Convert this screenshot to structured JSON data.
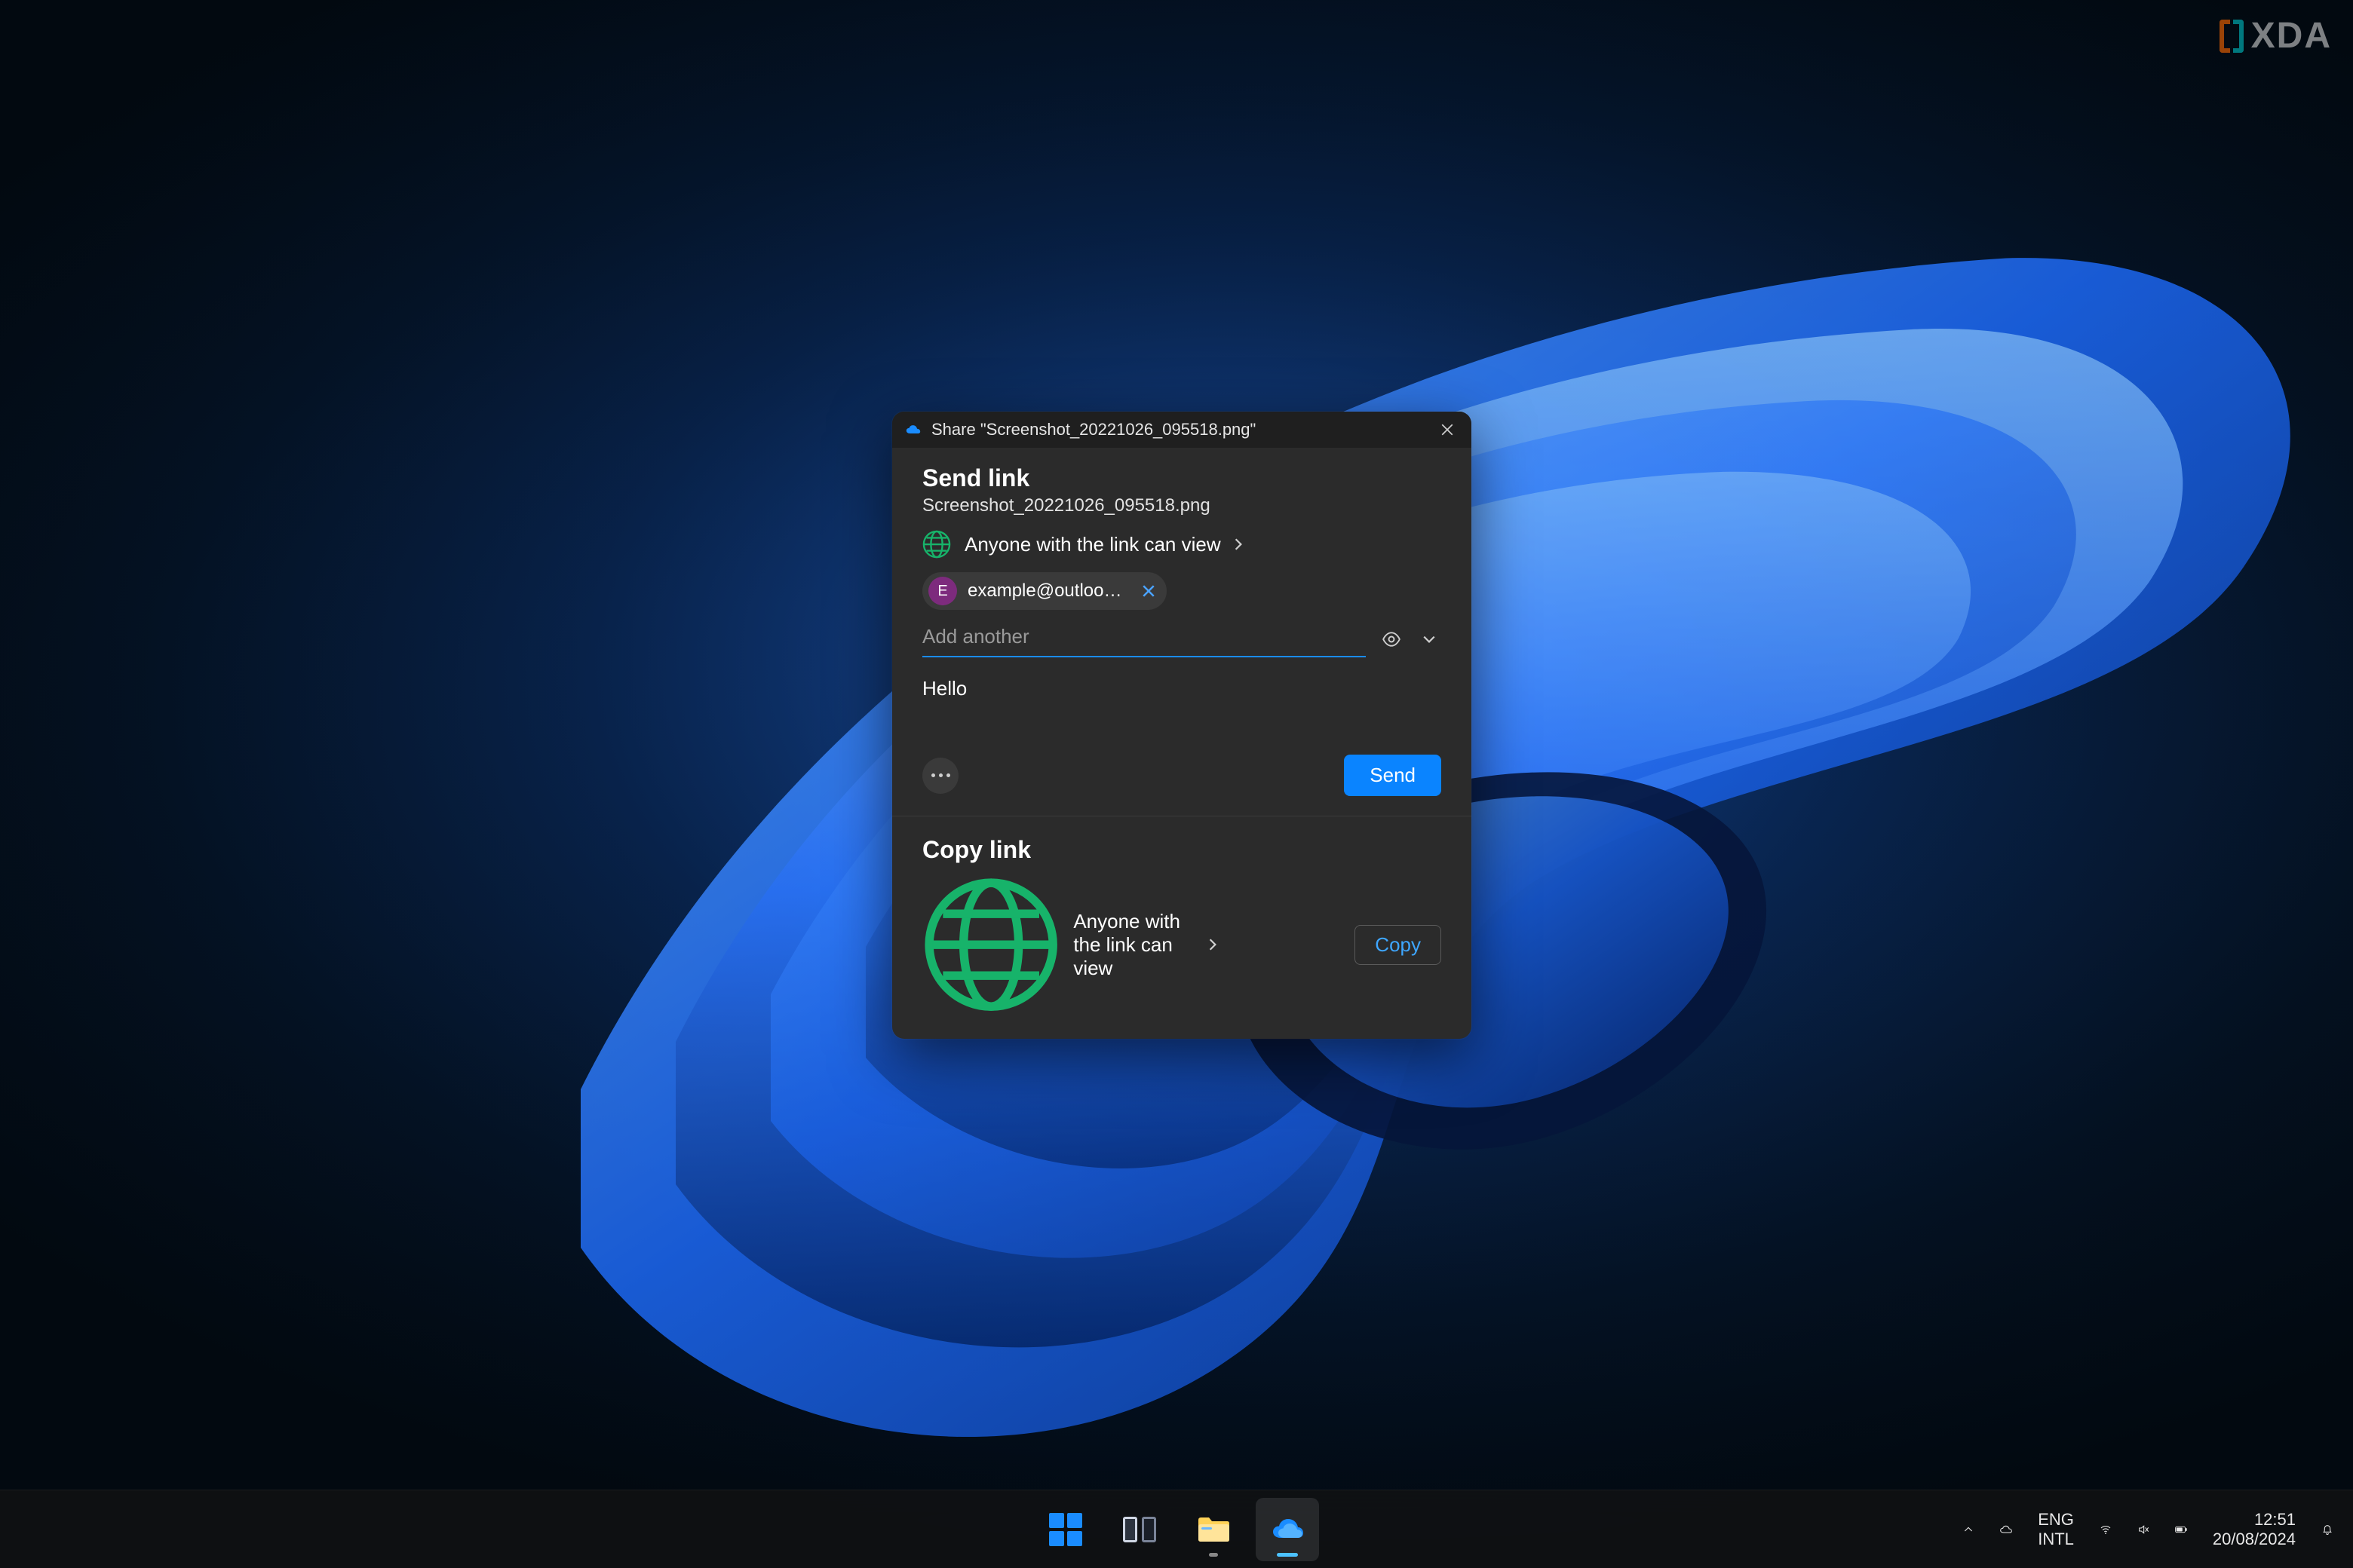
{
  "dialog": {
    "titlebar": {
      "prefix": "Share",
      "filename_quoted": "\"Screenshot_20221026_095518.png\""
    },
    "send_link_heading": "Send link",
    "filename": "Screenshot_20221026_095518.png",
    "permission_text": "Anyone with the link can view",
    "recipient": {
      "initial": "E",
      "email": "example@outlook...."
    },
    "add_another_placeholder": "Add another",
    "message_value": "Hello",
    "send_label": "Send",
    "copy_link_heading": "Copy link",
    "copy_permission_text": "Anyone with the link can view",
    "copy_label": "Copy"
  },
  "taskbar": {
    "language_line1": "ENG",
    "language_line2": "INTL",
    "time": "12:51",
    "date": "20/08/2024"
  },
  "watermark": {
    "text": "XDA"
  },
  "colors": {
    "accent": "#0a84ff",
    "link": "#3ea6ff",
    "dialog_bg": "#2b2b2b",
    "titlebar_bg": "#1f1f1f"
  }
}
